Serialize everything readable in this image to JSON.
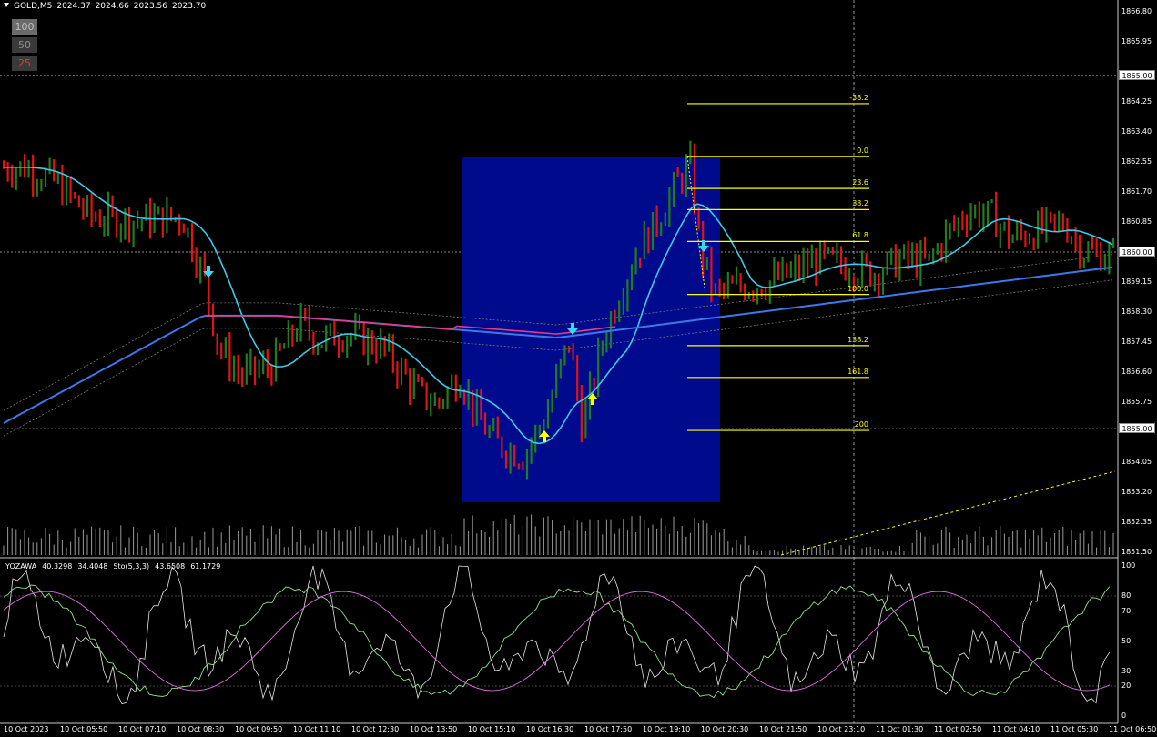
{
  "header": {
    "symbol": "GOLD,M5",
    "open": "2024.37",
    "high": "2024.66",
    "low": "2023.56",
    "close": "2023.70"
  },
  "period_buttons": [
    {
      "label": "100",
      "bg": "#6b6b6b",
      "fg": "#bdbdbd"
    },
    {
      "label": "50",
      "bg": "#3a3a3a",
      "fg": "#8c8c8c"
    },
    {
      "label": "25",
      "bg": "#3a3a3a",
      "fg": "#d23c3c"
    }
  ],
  "price_axis": {
    "labels": [
      "1866.80",
      "1865.95",
      "1864.25",
      "1863.40",
      "1862.55",
      "1861.70",
      "1860.85",
      "1859.15",
      "1858.30",
      "1857.45",
      "1856.60",
      "1855.75",
      "1854.05",
      "1853.20",
      "1852.35",
      "1851.50"
    ],
    "boxes": [
      "1865.00",
      "1860.00",
      "1855.00"
    ]
  },
  "time_axis": {
    "labels": [
      "10 Oct 2023",
      "10 Oct 05:50",
      "10 Oct 07:10",
      "10 Oct 08:30",
      "10 Oct 09:50",
      "10 Oct 11:10",
      "10 Oct 12:30",
      "10 Oct 13:50",
      "10 Oct 15:10",
      "10 Oct 16:30",
      "10 Oct 17:50",
      "10 Oct 19:10",
      "10 Oct 20:30",
      "10 Oct 21:50",
      "10 Oct 23:10",
      "11 Oct 01:30",
      "11 Oct 02:50",
      "11 Oct 04:10",
      "11 Oct 05:30",
      "11 Oct 06:50"
    ]
  },
  "fibonacci": {
    "levels": [
      {
        "label": "-38.2",
        "price": 1864.2
      },
      {
        "label": "0.0",
        "price": 1862.7
      },
      {
        "label": "23.6",
        "price": 1861.8
      },
      {
        "label": "38.2",
        "price": 1861.2
      },
      {
        "label": "61.8",
        "price": 1860.3
      },
      {
        "label": "100.0",
        "price": 1858.8
      },
      {
        "label": "138.2",
        "price": 1857.35
      },
      {
        "label": "161.8",
        "price": 1856.45
      },
      {
        "label": "200",
        "price": 1854.95
      }
    ],
    "color": "#ffff00"
  },
  "indicator": {
    "name": "YOZAWA",
    "v1": "40.3298",
    "v2": "34.4048",
    "stoch_name": "Sto(5,3,3)",
    "s1": "43.6508",
    "s2": "61.1729",
    "levels": [
      "100",
      "80",
      "70",
      "50",
      "30",
      "20",
      "0"
    ]
  },
  "colors": {
    "bull": "#1e7d1e",
    "bear": "#e01414",
    "ma_fast": "#40c8e8",
    "ma_slow": "#3c78e6",
    "ma_mid": "#e03c8c",
    "box": "#000a8c",
    "arrow_down": "#32dcf0",
    "arrow_up": "#ffff00"
  }
}
